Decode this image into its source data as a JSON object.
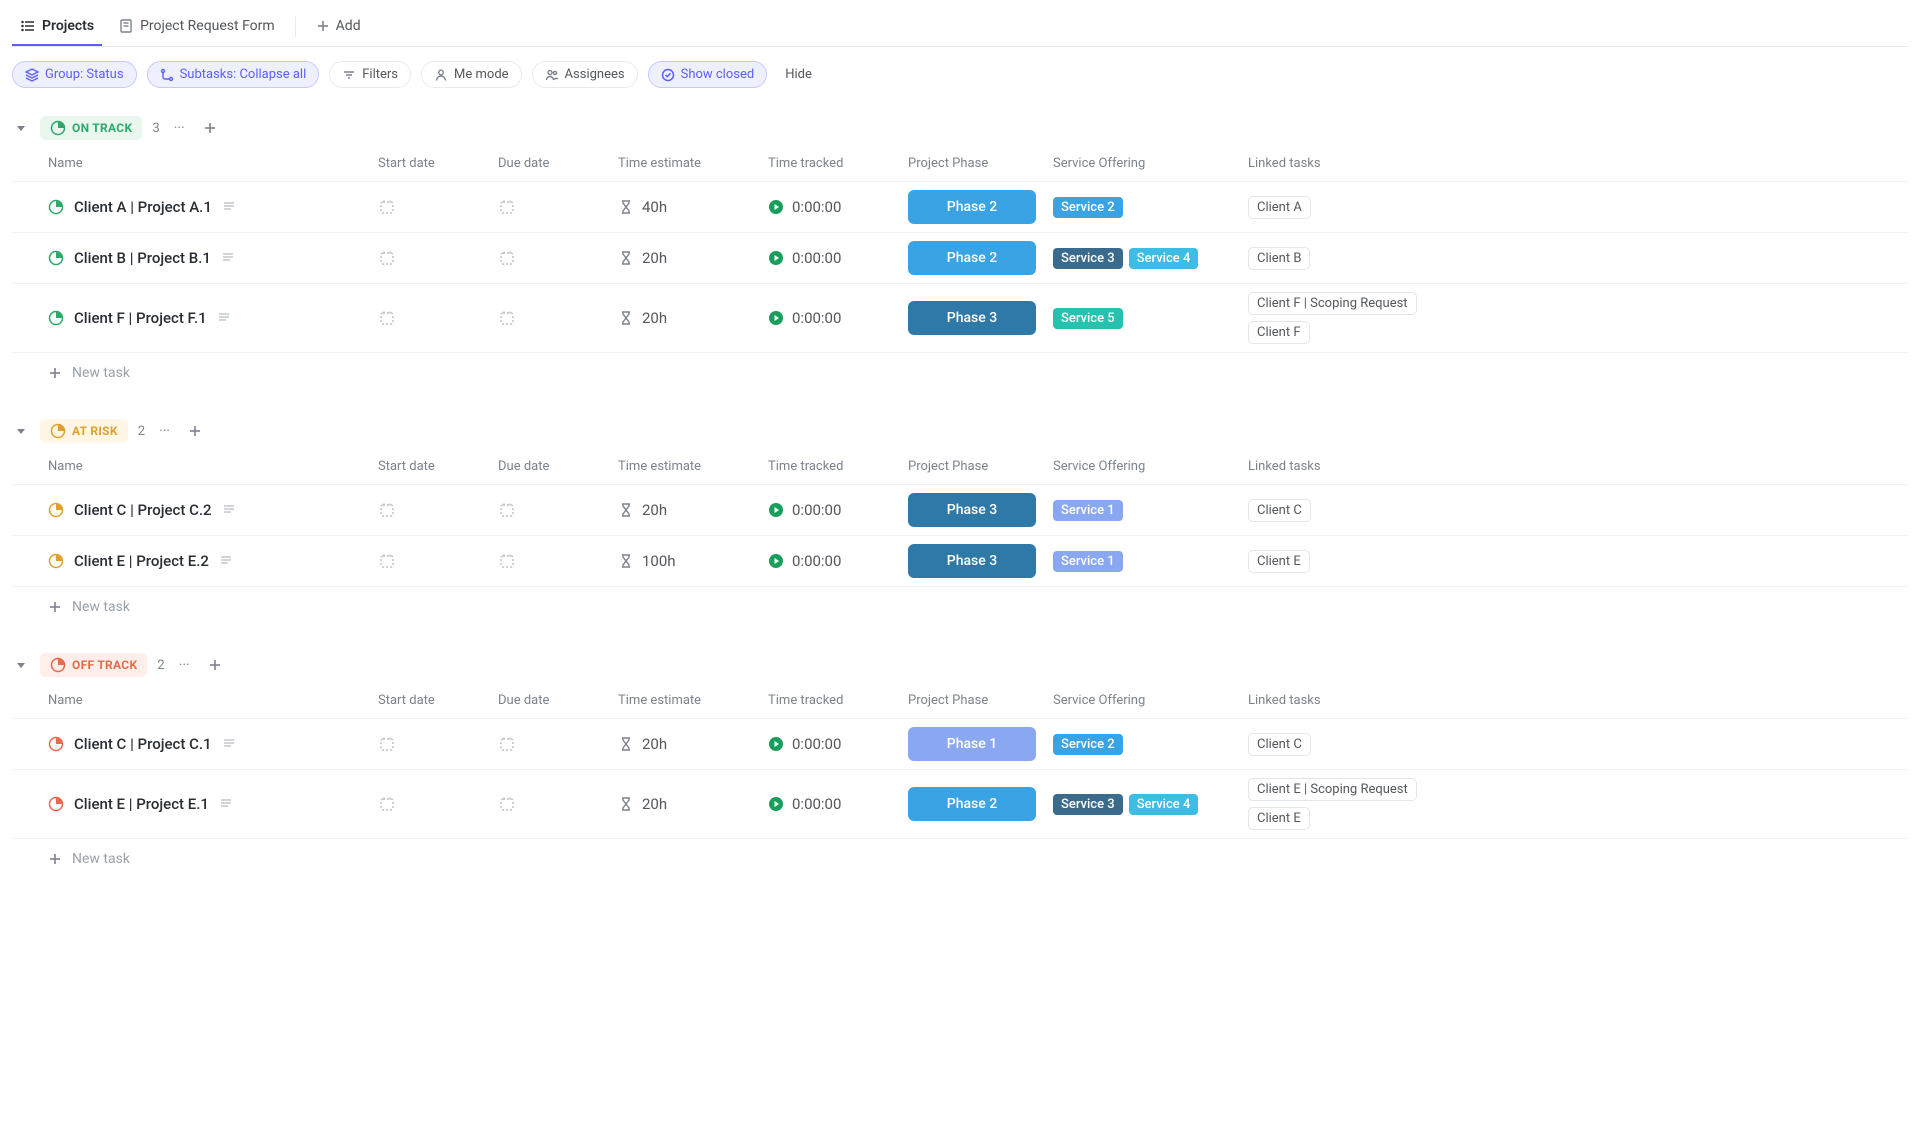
{
  "tabs": {
    "projects": "Projects",
    "request_form": "Project Request Form",
    "add": "Add"
  },
  "toolbar": {
    "group": "Group: Status",
    "subtasks": "Subtasks: Collapse all",
    "filters": "Filters",
    "me_mode": "Me mode",
    "assignees": "Assignees",
    "show_closed": "Show closed",
    "hide": "Hide"
  },
  "columns": {
    "name": "Name",
    "start": "Start date",
    "due": "Due date",
    "est": "Time estimate",
    "tracked": "Time tracked",
    "phase": "Project Phase",
    "service": "Service Offering",
    "linked": "Linked tasks"
  },
  "new_task_label": "New task",
  "groups": [
    {
      "key": "ontrack",
      "label": "ON TRACK",
      "count": "3",
      "pill_class": "ontrack",
      "status_color": "#2ea86b",
      "rows": [
        {
          "name": "Client A | Project A.1",
          "est": "40h",
          "tracked": "0:00:00",
          "phase": {
            "label": "Phase 2",
            "class": "phase2"
          },
          "services": [
            {
              "label": "Service 2",
              "class": "svc2"
            }
          ],
          "linked": [
            "Client A"
          ],
          "tall": false
        },
        {
          "name": "Client B | Project B.1",
          "est": "20h",
          "tracked": "0:00:00",
          "phase": {
            "label": "Phase 2",
            "class": "phase2"
          },
          "services": [
            {
              "label": "Service 3",
              "class": "svc3"
            },
            {
              "label": "Service 4",
              "class": "svc4"
            }
          ],
          "linked": [
            "Client B"
          ],
          "tall": false
        },
        {
          "name": "Client F | Project F.1",
          "est": "20h",
          "tracked": "0:00:00",
          "phase": {
            "label": "Phase 3",
            "class": "phase3"
          },
          "services": [
            {
              "label": "Service 5",
              "class": "svc5"
            }
          ],
          "linked": [
            "Client F | Scoping Request",
            "Client F"
          ],
          "tall": true
        }
      ]
    },
    {
      "key": "atrisk",
      "label": "AT RISK",
      "count": "2",
      "pill_class": "atrisk",
      "status_color": "#e0a030",
      "rows": [
        {
          "name": "Client C | Project C.2",
          "est": "20h",
          "tracked": "0:00:00",
          "phase": {
            "label": "Phase 3",
            "class": "phase3"
          },
          "services": [
            {
              "label": "Service 1",
              "class": "svc1"
            }
          ],
          "linked": [
            "Client C"
          ],
          "tall": false
        },
        {
          "name": "Client E | Project E.2",
          "est": "100h",
          "tracked": "0:00:00",
          "phase": {
            "label": "Phase 3",
            "class": "phase3"
          },
          "services": [
            {
              "label": "Service 1",
              "class": "svc1"
            }
          ],
          "linked": [
            "Client E"
          ],
          "tall": false
        }
      ]
    },
    {
      "key": "offtrack",
      "label": "OFF TRACK",
      "count": "2",
      "pill_class": "offtrack",
      "status_color": "#e66a4c",
      "rows": [
        {
          "name": "Client C | Project C.1",
          "est": "20h",
          "tracked": "0:00:00",
          "phase": {
            "label": "Phase 1",
            "class": "phase1"
          },
          "services": [
            {
              "label": "Service 2",
              "class": "svc2"
            }
          ],
          "linked": [
            "Client C"
          ],
          "tall": false
        },
        {
          "name": "Client E | Project E.1",
          "est": "20h",
          "tracked": "0:00:00",
          "phase": {
            "label": "Phase 2",
            "class": "phase2"
          },
          "services": [
            {
              "label": "Service 3",
              "class": "svc3"
            },
            {
              "label": "Service 4",
              "class": "svc4"
            }
          ],
          "linked": [
            "Client E | Scoping Request",
            "Client E"
          ],
          "tall": true
        }
      ]
    }
  ]
}
